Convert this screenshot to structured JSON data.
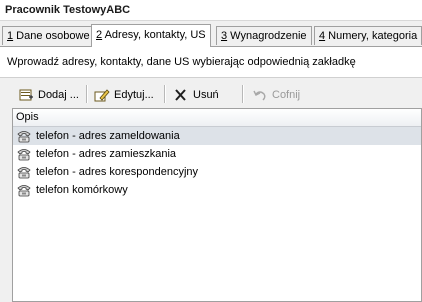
{
  "window": {
    "title": "Pracownik TestowyABC"
  },
  "tabs": [
    {
      "key": "1",
      "label": " Dane osobowe"
    },
    {
      "key": "2",
      "label": " Adresy, kontakty, US"
    },
    {
      "key": "3",
      "label": " Wynagrodzenie"
    },
    {
      "key": "4",
      "label": " Numery, kategoria"
    }
  ],
  "hint": "Wprowadź adresy, kontakty, dane US wybierając odpowiednią zakładkę",
  "toolbar": {
    "add": {
      "label": "Dodaj ...",
      "icon": "add-record-icon"
    },
    "edit": {
      "label": "Edytuj...",
      "icon": "edit-icon"
    },
    "delete": {
      "label": "Usuń",
      "icon": "delete-x-icon"
    },
    "undo": {
      "label": "Cofnij",
      "icon": "undo-icon",
      "disabled": true
    }
  },
  "list": {
    "column": "Opis",
    "rows": [
      {
        "label": "telefon - adres zameldowania",
        "icon": "phone-icon",
        "selected": true
      },
      {
        "label": "telefon - adres zamieszkania",
        "icon": "phone-icon"
      },
      {
        "label": "telefon - adres korespondencyjny",
        "icon": "phone-icon"
      },
      {
        "label": "telefon komórkowy",
        "icon": "phone-icon"
      }
    ]
  },
  "colors": {
    "highlight": "#f6f21a",
    "selection": "#dde2e8"
  }
}
